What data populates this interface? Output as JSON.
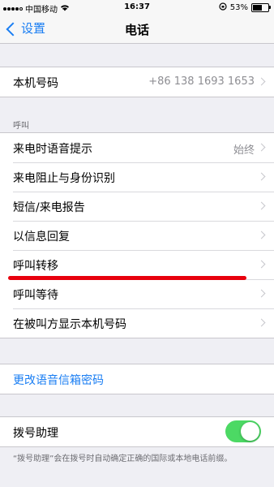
{
  "status_bar": {
    "carrier": "中国移动",
    "time": "16:37",
    "battery": "53%",
    "battery_level": 0.53
  },
  "nav": {
    "back_label": "设置",
    "title": "电话"
  },
  "my_number": {
    "label": "本机号码",
    "value": "+86 138 1693 1653"
  },
  "calls_section": {
    "header": "呼叫",
    "items": [
      {
        "label": "来电时语音提示",
        "value": "始终"
      },
      {
        "label": "来电阻止与身份识别",
        "value": ""
      },
      {
        "label": "短信/来电报告",
        "value": ""
      },
      {
        "label": "以信息回复",
        "value": ""
      },
      {
        "label": "呼叫转移",
        "value": ""
      },
      {
        "label": "呼叫等待",
        "value": ""
      },
      {
        "label": "在被叫方显示本机号码",
        "value": ""
      }
    ]
  },
  "voicemail": {
    "label": "更改语音信箱密码"
  },
  "dial_assist": {
    "label": "拨号助理",
    "enabled": true,
    "note": "“拨号助理”会在拨号时自动确定正确的国际或本地电话前缀。"
  },
  "colors": {
    "accent": "#1a7ef3",
    "toggle_on": "#4cd964",
    "annotation_red": "#e8000d"
  }
}
